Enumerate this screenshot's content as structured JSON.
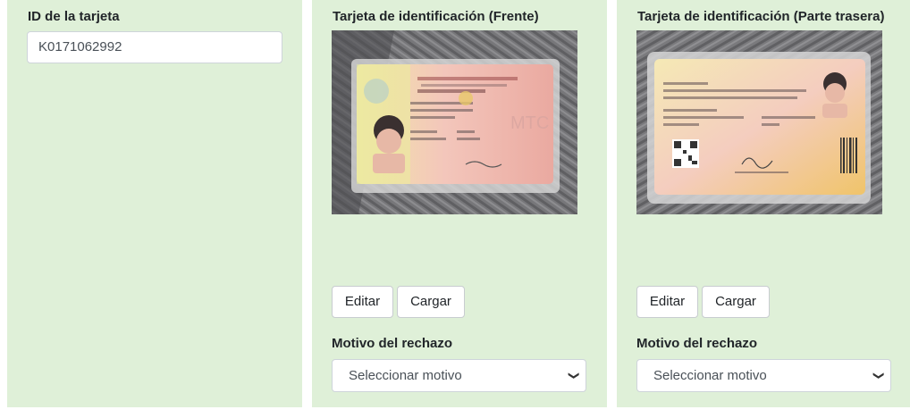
{
  "card_id": {
    "label": "ID de la tarjeta",
    "value": "K0171062992"
  },
  "front": {
    "label": "Tarjeta de identificación (Frente)",
    "image_icon": "id-card-front-photo",
    "edit_label": "Editar",
    "upload_label": "Cargar",
    "reason_label": "Motivo del rechazo",
    "reason_selected": "Seleccionar motivo"
  },
  "back": {
    "label": "Tarjeta de identificación (Parte trasera)",
    "image_icon": "id-card-back-photo",
    "edit_label": "Editar",
    "upload_label": "Cargar",
    "reason_label": "Motivo del rechazo",
    "reason_selected": "Seleccionar motivo"
  },
  "colors": {
    "panel_background": "#dff0d8",
    "page_background": "#ffffff"
  }
}
